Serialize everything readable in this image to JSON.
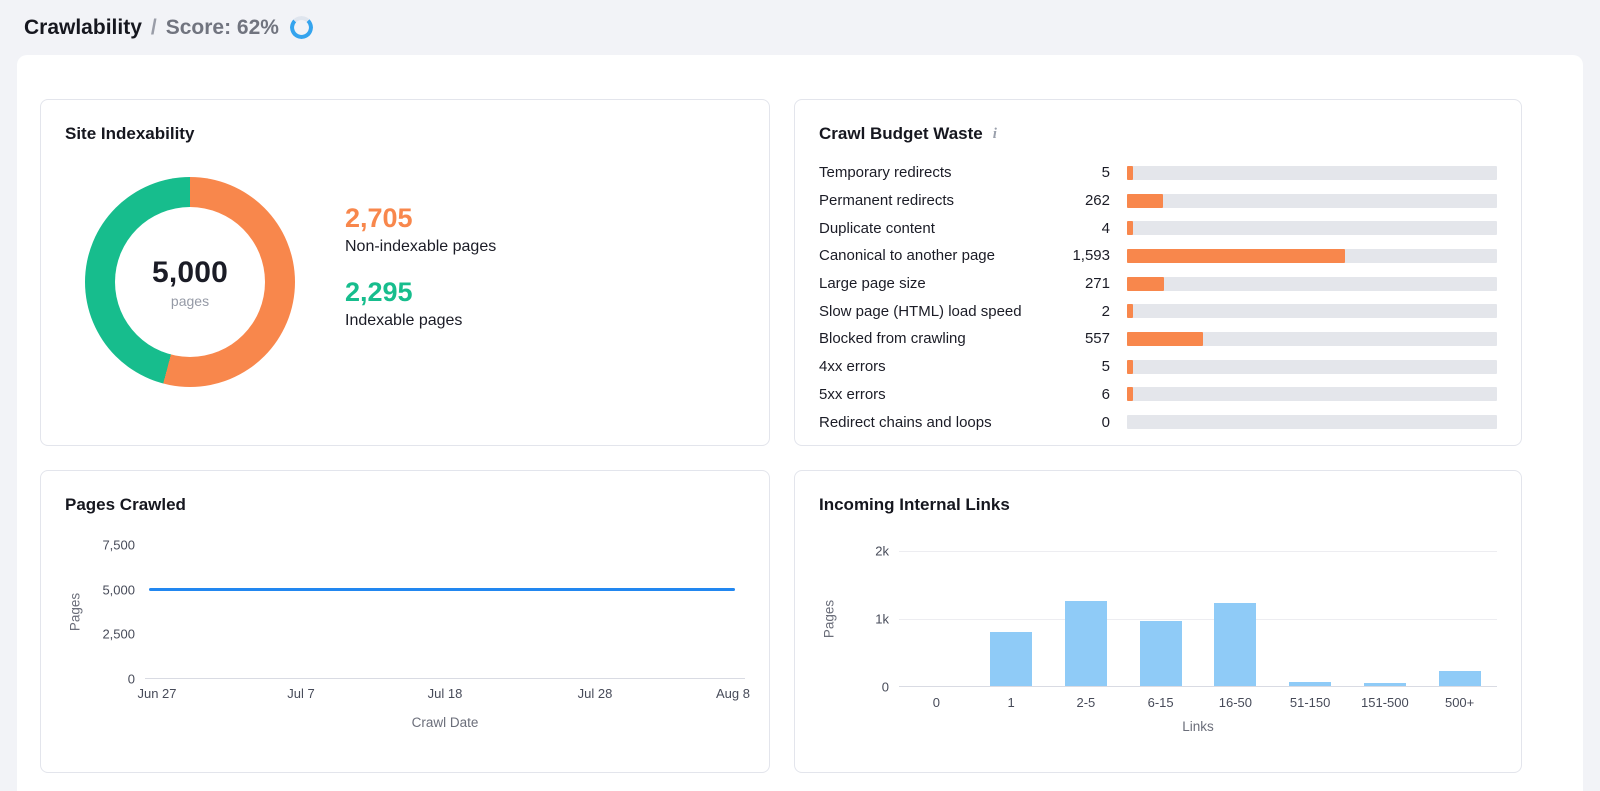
{
  "header": {
    "title": "Crawlability",
    "separator": "/",
    "score": "Score: 62%",
    "score_percent": 62
  },
  "colors": {
    "orange": "#f8874c",
    "green": "#17bd8d",
    "blue": "#2287f0",
    "lightblue": "#8fcbf7",
    "spinner_blue": "#35a4ee",
    "track": "#e4e6eb",
    "axis": "#d9dbe3",
    "grid": "#ededf1"
  },
  "cards": {
    "site_indexability": {
      "title": "Site Indexability",
      "donut": {
        "total": "5,000",
        "unit": "pages",
        "non_indexable": 2705,
        "indexable": 2295
      },
      "legend": [
        {
          "value": "2,705",
          "label": "Non-indexable pages",
          "color": "#f8874c"
        },
        {
          "value": "2,295",
          "label": "Indexable pages",
          "color": "#17bd8d"
        }
      ]
    },
    "crawl_budget_waste": {
      "title": "Crawl Budget Waste",
      "info_icon": "i",
      "scale_max": 2705,
      "rows": [
        {
          "label": "Temporary redirects",
          "value": "5",
          "num": 5
        },
        {
          "label": "Permanent redirects",
          "value": "262",
          "num": 262
        },
        {
          "label": "Duplicate content",
          "value": "4",
          "num": 4
        },
        {
          "label": "Canonical to another page",
          "value": "1,593",
          "num": 1593
        },
        {
          "label": "Large page size",
          "value": "271",
          "num": 271
        },
        {
          "label": "Slow page (HTML) load speed",
          "value": "2",
          "num": 2
        },
        {
          "label": "Blocked from crawling",
          "value": "557",
          "num": 557
        },
        {
          "label": "4xx errors",
          "value": "5",
          "num": 5
        },
        {
          "label": "5xx errors",
          "value": "6",
          "num": 6
        },
        {
          "label": "Redirect chains and loops",
          "value": "0",
          "num": 0
        }
      ]
    },
    "pages_crawled": {
      "title": "Pages Crawled",
      "ylabel": "Pages",
      "xlabel": "Crawl Date",
      "yticks": [
        "7,500",
        "5,000",
        "2,500",
        "0"
      ],
      "xticks": [
        "Jun 27",
        "Jul 7",
        "Jul 18",
        "Jul 28",
        "Aug 8"
      ]
    },
    "incoming_internal_links": {
      "title": "Incoming Internal Links",
      "ylabel": "Pages",
      "xlabel": "Links",
      "yticks": [
        "2k",
        "1k",
        "0"
      ]
    }
  },
  "chart_data": [
    {
      "type": "pie",
      "title": "Site Indexability",
      "labels": [
        "Non-indexable pages",
        "Indexable pages"
      ],
      "values": [
        2705,
        2295
      ],
      "total": 5000,
      "unit": "pages",
      "colors": [
        "#f8874c",
        "#17bd8d"
      ]
    },
    {
      "type": "bar",
      "orientation": "horizontal",
      "title": "Crawl Budget Waste",
      "categories": [
        "Temporary redirects",
        "Permanent redirects",
        "Duplicate content",
        "Canonical to another page",
        "Large page size",
        "Slow page (HTML) load speed",
        "Blocked from crawling",
        "4xx errors",
        "5xx errors",
        "Redirect chains and loops"
      ],
      "values": [
        5,
        262,
        4,
        1593,
        271,
        2,
        557,
        5,
        6,
        0
      ],
      "xlim": [
        0,
        2705
      ]
    },
    {
      "type": "line",
      "title": "Pages Crawled",
      "xlabel": "Crawl Date",
      "ylabel": "Pages",
      "x": [
        "Jun 27",
        "Jul 7",
        "Jul 18",
        "Jul 28",
        "Aug 8"
      ],
      "y": [
        5000,
        5000,
        5000,
        5000,
        5000
      ],
      "ylim": [
        0,
        7500
      ],
      "yticks": [
        0,
        2500,
        5000,
        7500
      ],
      "grid": false,
      "line_color": "#2287f0"
    },
    {
      "type": "bar",
      "title": "Incoming Internal Links",
      "xlabel": "Links",
      "ylabel": "Pages",
      "categories": [
        "0",
        "1",
        "2-5",
        "6-15",
        "16-50",
        "51-150",
        "151-500",
        "500+"
      ],
      "values": [
        0,
        800,
        1250,
        950,
        1220,
        60,
        50,
        220
      ],
      "ylim": [
        0,
        2000
      ],
      "yticks": [
        0,
        1000,
        2000
      ],
      "bar_color": "#8fcbf7"
    }
  ]
}
